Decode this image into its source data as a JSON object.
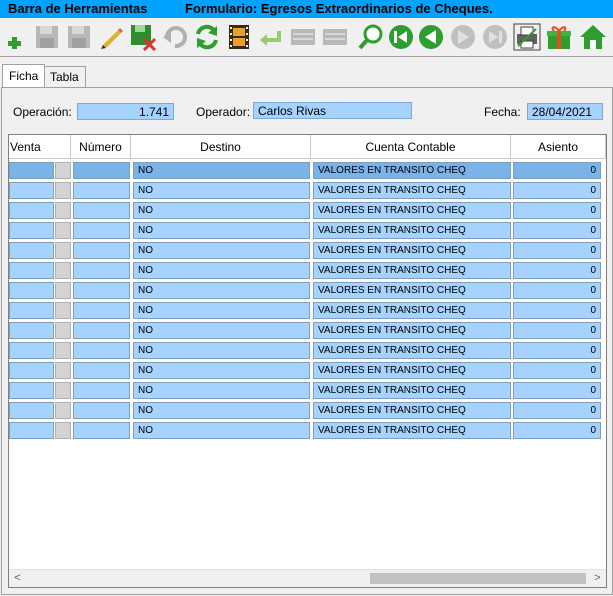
{
  "title": {
    "left": "Barra de Herramientas",
    "right": "Formulario: Egresos Extraordinarios de Cheques."
  },
  "toolbar": [
    {
      "name": "add-icon"
    },
    {
      "name": "save-disabled-icon"
    },
    {
      "name": "save-as-disabled-icon"
    },
    {
      "name": "edit-pencil-icon"
    },
    {
      "name": "delete-save-icon"
    },
    {
      "name": "undo-disabled-icon"
    },
    {
      "name": "refresh-icon"
    },
    {
      "name": "film-icon"
    },
    {
      "name": "return-arrow-icon"
    },
    {
      "name": "list-disabled-icon"
    },
    {
      "name": "list-disabled-icon-2"
    },
    {
      "name": "search-icon"
    },
    {
      "name": "first-record-icon"
    },
    {
      "name": "previous-record-icon"
    },
    {
      "name": "next-record-disabled-icon"
    },
    {
      "name": "last-record-disabled-icon"
    },
    {
      "name": "print-icon"
    },
    {
      "name": "gift-icon"
    },
    {
      "name": "home-icon"
    }
  ],
  "tabs": {
    "ficha": "Ficha",
    "tabla": "Tabla"
  },
  "form": {
    "operacion_label": "Operación:",
    "operacion_value": "1.741",
    "operador_label": "Operador:",
    "operador_value": "Carlos Rivas",
    "fecha_label": "Fecha:",
    "fecha_value": "28/04/2021"
  },
  "grid": {
    "headers": [
      "Venta",
      "Número",
      "Destino",
      "Cuenta Contable",
      "Asiento"
    ],
    "rows": [
      {
        "destino": "NO",
        "cuenta": "VALORES EN TRANSITO CHEQ",
        "asiento": "0"
      },
      {
        "destino": "NO",
        "cuenta": "VALORES EN TRANSITO CHEQ",
        "asiento": "0"
      },
      {
        "destino": "NO",
        "cuenta": "VALORES EN TRANSITO CHEQ",
        "asiento": "0"
      },
      {
        "destino": "NO",
        "cuenta": "VALORES EN TRANSITO CHEQ",
        "asiento": "0"
      },
      {
        "destino": "NO",
        "cuenta": "VALORES EN TRANSITO CHEQ",
        "asiento": "0"
      },
      {
        "destino": "NO",
        "cuenta": "VALORES EN TRANSITO CHEQ",
        "asiento": "0"
      },
      {
        "destino": "NO",
        "cuenta": "VALORES EN TRANSITO CHEQ",
        "asiento": "0"
      },
      {
        "destino": "NO",
        "cuenta": "VALORES EN TRANSITO CHEQ",
        "asiento": "0"
      },
      {
        "destino": "NO",
        "cuenta": "VALORES EN TRANSITO CHEQ",
        "asiento": "0"
      },
      {
        "destino": "NO",
        "cuenta": "VALORES EN TRANSITO CHEQ",
        "asiento": "0"
      },
      {
        "destino": "NO",
        "cuenta": "VALORES EN TRANSITO CHEQ",
        "asiento": "0"
      },
      {
        "destino": "NO",
        "cuenta": "VALORES EN TRANSITO CHEQ",
        "asiento": "0"
      },
      {
        "destino": "NO",
        "cuenta": "VALORES EN TRANSITO CHEQ",
        "asiento": "0"
      },
      {
        "destino": "NO",
        "cuenta": "VALORES EN TRANSITO CHEQ",
        "asiento": "0"
      }
    ]
  },
  "scroll": {
    "left_arrow": "<",
    "right_arrow": ">"
  }
}
